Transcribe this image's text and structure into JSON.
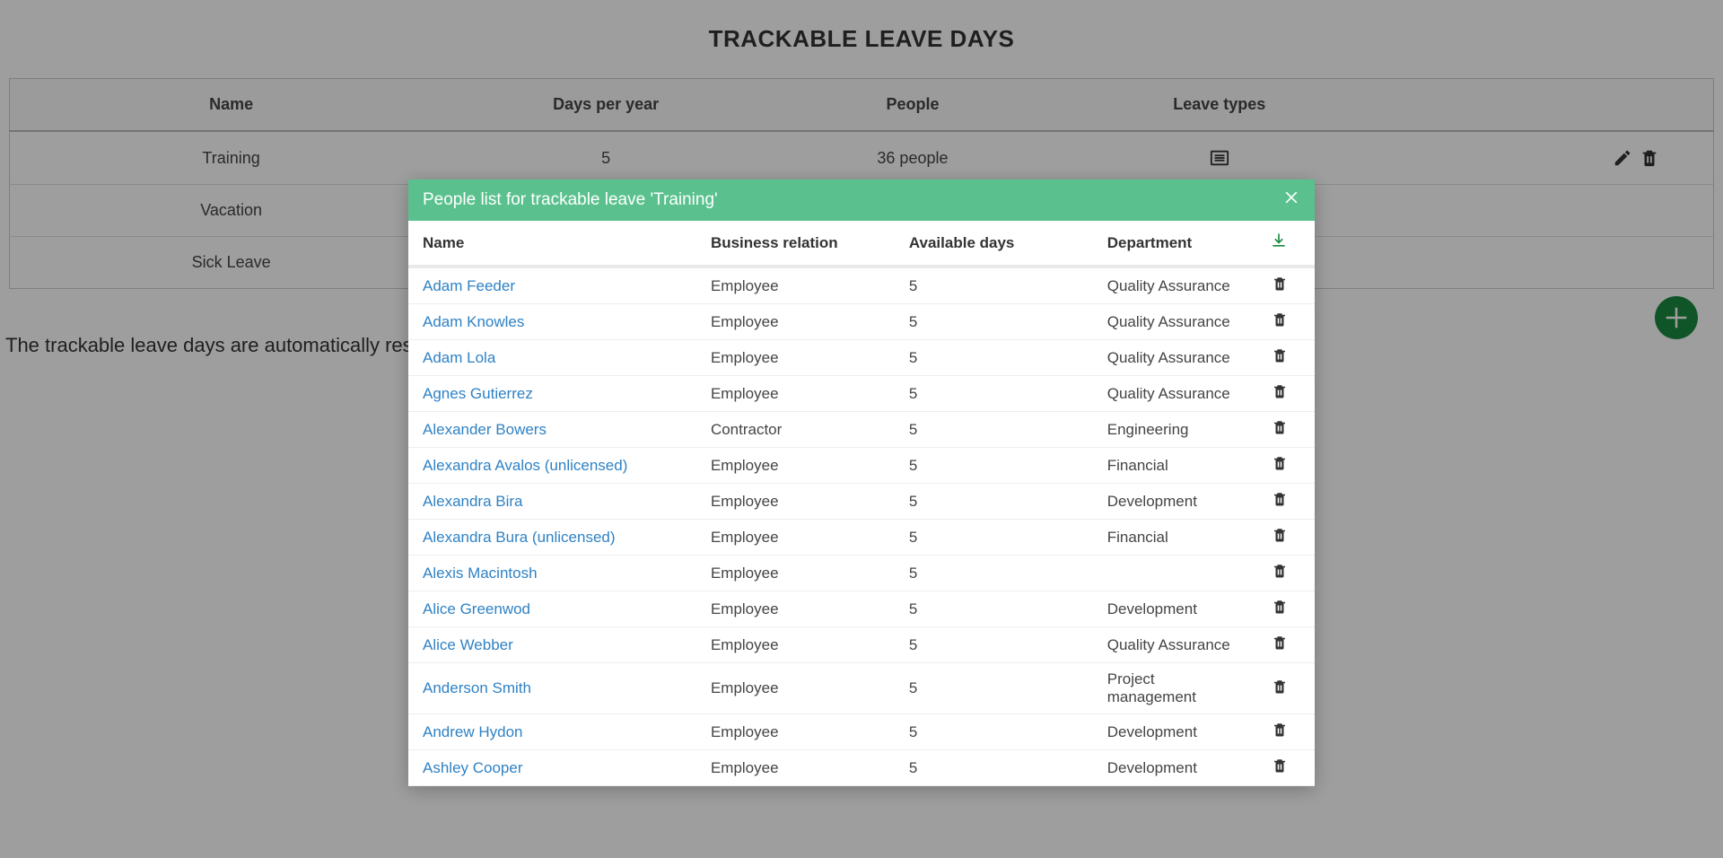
{
  "page": {
    "title": "TRACKABLE LEAVE DAYS",
    "reset_text": "The trackable leave days are automatically reset on"
  },
  "leave_table": {
    "headers": {
      "name": "Name",
      "days_per_year": "Days per year",
      "people": "People",
      "leave_types": "Leave types"
    },
    "rows": [
      {
        "name": "Training",
        "days": "5",
        "people": "36 people"
      },
      {
        "name": "Vacation",
        "days": "",
        "people": ""
      },
      {
        "name": "Sick Leave",
        "days": "",
        "people": ""
      }
    ]
  },
  "modal": {
    "title": "People list for trackable leave 'Training'",
    "headers": {
      "name": "Name",
      "relation": "Business relation",
      "available": "Available days",
      "department": "Department"
    },
    "rows": [
      {
        "name": "Adam Feeder",
        "relation": "Employee",
        "days": "5",
        "department": "Quality Assurance"
      },
      {
        "name": "Adam Knowles",
        "relation": "Employee",
        "days": "5",
        "department": "Quality Assurance"
      },
      {
        "name": "Adam Lola",
        "relation": "Employee",
        "days": "5",
        "department": "Quality Assurance"
      },
      {
        "name": "Agnes Gutierrez",
        "relation": "Employee",
        "days": "5",
        "department": "Quality Assurance"
      },
      {
        "name": "Alexander Bowers",
        "relation": "Contractor",
        "days": "5",
        "department": "Engineering"
      },
      {
        "name": "Alexandra Avalos (unlicensed)",
        "relation": "Employee",
        "days": "5",
        "department": "Financial"
      },
      {
        "name": "Alexandra Bira",
        "relation": "Employee",
        "days": "5",
        "department": "Development"
      },
      {
        "name": "Alexandra Bura (unlicensed)",
        "relation": "Employee",
        "days": "5",
        "department": "Financial"
      },
      {
        "name": "Alexis Macintosh",
        "relation": "Employee",
        "days": "5",
        "department": ""
      },
      {
        "name": "Alice Greenwod",
        "relation": "Employee",
        "days": "5",
        "department": "Development"
      },
      {
        "name": "Alice Webber",
        "relation": "Employee",
        "days": "5",
        "department": "Quality Assurance"
      },
      {
        "name": "Anderson Smith",
        "relation": "Employee",
        "days": "5",
        "department": "Project management"
      },
      {
        "name": "Andrew Hydon",
        "relation": "Employee",
        "days": "5",
        "department": "Development"
      },
      {
        "name": "Ashley Cooper",
        "relation": "Employee",
        "days": "5",
        "department": "Development"
      }
    ]
  }
}
